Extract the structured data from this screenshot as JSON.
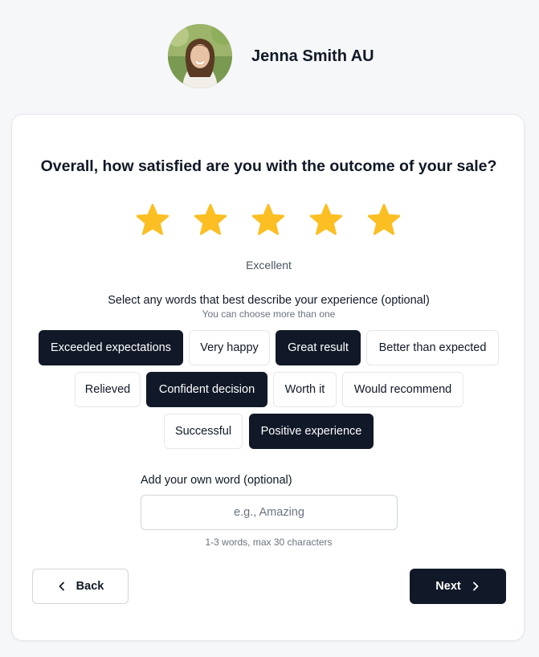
{
  "agent": {
    "name": "Jenna Smith AU"
  },
  "survey": {
    "question": "Overall, how satisfied are you with the outcome of your sale?",
    "rating": 5,
    "rating_max": 5,
    "rating_label": "Excellent",
    "star_color": "#fbbf24",
    "words_title": "Select any words that best describe your experience (optional)",
    "words_subtitle": "You can choose more than one",
    "chips": [
      {
        "label": "Exceeded expectations",
        "selected": true
      },
      {
        "label": "Very happy",
        "selected": false
      },
      {
        "label": "Great result",
        "selected": true
      },
      {
        "label": "Better than expected",
        "selected": false
      },
      {
        "label": "Relieved",
        "selected": false
      },
      {
        "label": "Confident decision",
        "selected": true
      },
      {
        "label": "Worth it",
        "selected": false
      },
      {
        "label": "Would recommend",
        "selected": false
      },
      {
        "label": "Successful",
        "selected": false
      },
      {
        "label": "Positive experience",
        "selected": true
      }
    ],
    "own_word": {
      "label": "Add your own word (optional)",
      "placeholder": "e.g., Amazing",
      "value": "",
      "hint": "1-3 words, max 30 characters"
    }
  },
  "nav": {
    "back_label": "Back",
    "next_label": "Next"
  },
  "colors": {
    "selected_chip_bg": "#111827",
    "background": "#f6f7f9"
  }
}
